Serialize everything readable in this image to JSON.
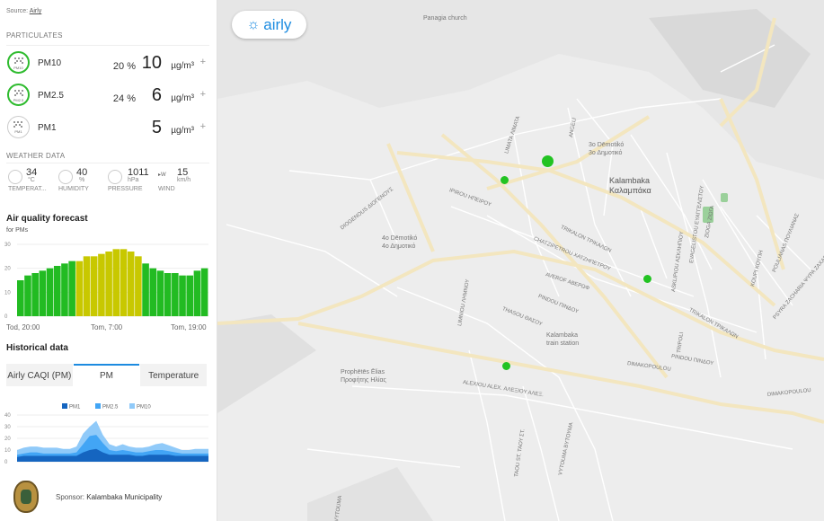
{
  "source": {
    "prefix": "Source:",
    "link": "Airly"
  },
  "particulates": {
    "heading": "PARTICULATES",
    "rows": [
      {
        "name": "PM10",
        "percent": "20 %",
        "value": "10",
        "unit": "µg/m³",
        "active": true,
        "icon_tag": "PM10"
      },
      {
        "name": "PM2.5",
        "percent": "24 %",
        "value": "6",
        "unit": "µg/m³",
        "active": true,
        "icon_tag": "PM2.5"
      },
      {
        "name": "PM1",
        "percent": "",
        "value": "5",
        "unit": "µg/m³",
        "active": false,
        "icon_tag": "PM1"
      }
    ],
    "plus": "+"
  },
  "weather": {
    "heading": "WEATHER DATA",
    "temperature": {
      "value": "34",
      "unit": "°C",
      "label": "TEMPERAT..."
    },
    "humidity": {
      "value": "40",
      "unit": "%",
      "label": "HUMIDITY"
    },
    "pressure": {
      "value": "1011",
      "unit": "hPa",
      "label": "PRESSURE"
    },
    "wind": {
      "value": "15",
      "unit": "km/h",
      "label": "WIND",
      "direction": "W"
    }
  },
  "forecast": {
    "title": "Air quality forecast",
    "subtitle": "for PMs",
    "ticks": [
      "Tod, 20:00",
      "Tom, 7:00",
      "Tom, 19:00"
    ]
  },
  "historical": {
    "title": "Historical data",
    "tabs": [
      "Airly CAQI (PM)",
      "PM",
      "Temperature"
    ],
    "active_tab": 1,
    "legend": [
      "PM1",
      "PM2.5",
      "PM10"
    ]
  },
  "sponsor": {
    "label": "Sponsor:",
    "name": "Kalambaka Municipality"
  },
  "map": {
    "brand": "airly",
    "labels": {
      "panagia": "Panagia church",
      "demotiko3": "3o Dēmotikó",
      "demotiko3_gr": "3ο Δημοτικό",
      "kalambaka": "Kalambaka",
      "kalambaka_gr": "Καλαμπάκα",
      "demotiko4": "4o Dēmotikó",
      "demotiko4_gr": "4ο Δημοτικό",
      "station": "Kalambaka",
      "station2": "train station",
      "prophet": "Prophētēs Ēlias",
      "prophet_gr": "Προφήτης Ηλίας"
    },
    "streets": {
      "limata": "LIMATA ΛΙΜΑΤΑ",
      "angeli": "ANGELI",
      "ipirou": "IPIROU ΗΠΕΙΡΟΥ",
      "diogenous": "DIOGENOUS ΔΙΟΓΕΝΟΥΣ",
      "chatzipetrou": "CHATZIPETROU ΧΑΤΖΗΠΕΤΡΟΥ",
      "trikalon": "TRIKALON ΤΡΙΚΑΛΩΝ",
      "averof": "AVEROF ΑΒΕΡΩΦ",
      "pindou": "PINDOU ΠΙΝΔΟΥ",
      "thasou": "THASOU ΘΑΣΟΥ",
      "limniou": "LIMNIOU ΛΗΜΝΟΥ",
      "alexiou": "ALEXIOU ALEX. ΑΛΕΞΙΟΥ ΑΛΕΞ.",
      "tavou": "TAOU ST. ΤΑΟΥ ΣΤ.",
      "vytoumia": "VYTOUMA ΒΥΤΟΥΜΑ",
      "vytoumia2": "VYTOUMA",
      "dimakopoulou": "DIMAKOPOULOU",
      "dimakopoulou2": "DIMAKOPOULOU",
      "pindou2": "PINDOU ΠΙΝΔΟΥ",
      "trikalon2": "TRIKALON ΤΡΙΚΑΛΩΝ",
      "asklipiou": "ASKLIPIOU ΑΣΚΛΗΠΙΟΥ",
      "evagelistou": "EVAGELISTOU ΕΥΑΓΓΕΛΙΣΤΟΥ",
      "zioga": "ZIOGA ΖΙΩΓΑ",
      "koupi": "KOUPI ΚΟΥΠΗ",
      "poulianas": "POULIANAS ΠΟΥΛΙΑΝΑΣ",
      "psyra": "PSYRA ZACHARIA ΨΥΡΑ ΖΑΧΑΡΙΑ",
      "tripoli": "TRIPOLI"
    }
  },
  "chart_data": [
    {
      "type": "bar",
      "title": "Air quality forecast",
      "subtitle": "for PMs",
      "yticks": [
        0,
        10,
        20,
        30
      ],
      "ylim": [
        0,
        30
      ],
      "xticks": [
        "Tod, 20:00",
        "Tom, 7:00",
        "Tom, 19:00"
      ],
      "values": [
        15,
        17,
        18,
        19,
        20,
        21,
        22,
        23,
        23,
        25,
        25,
        26,
        27,
        28,
        28,
        27,
        25,
        22,
        20,
        19,
        18,
        18,
        17,
        17,
        19,
        20
      ],
      "colors": [
        "#22bb22",
        "#22bb22",
        "#22bb22",
        "#22bb22",
        "#22bb22",
        "#22bb22",
        "#22bb22",
        "#22bb22",
        "#c8c800",
        "#c8c800",
        "#c8c800",
        "#c8c800",
        "#c8c800",
        "#c8c800",
        "#c8c800",
        "#c8c800",
        "#c8c800",
        "#22bb22",
        "#22bb22",
        "#22bb22",
        "#22bb22",
        "#22bb22",
        "#22bb22",
        "#22bb22",
        "#22bb22",
        "#22bb22"
      ]
    },
    {
      "type": "area",
      "title": "Historical data",
      "yticks": [
        0,
        10,
        20,
        30,
        40
      ],
      "ylim": [
        0,
        40
      ],
      "series": [
        {
          "name": "PM10",
          "color": "#90caf9",
          "values": [
            10,
            12,
            13,
            13,
            12,
            12,
            12,
            11,
            11,
            13,
            24,
            30,
            35,
            23,
            15,
            13,
            15,
            13,
            12,
            12,
            13,
            15,
            16,
            14,
            12,
            10,
            10,
            11,
            11,
            11
          ]
        },
        {
          "name": "PM2.5",
          "color": "#42a5f5",
          "values": [
            6,
            7,
            8,
            8,
            7,
            7,
            7,
            7,
            7,
            8,
            15,
            22,
            23,
            16,
            10,
            9,
            10,
            9,
            8,
            8,
            9,
            10,
            10,
            9,
            8,
            7,
            7,
            7,
            7,
            7
          ]
        },
        {
          "name": "PM1",
          "color": "#1565c0",
          "values": [
            4,
            5,
            5,
            5,
            5,
            5,
            5,
            5,
            5,
            5,
            8,
            10,
            11,
            8,
            6,
            6,
            6,
            6,
            5,
            5,
            6,
            6,
            6,
            6,
            5,
            5,
            5,
            5,
            5,
            5
          ]
        }
      ]
    }
  ]
}
